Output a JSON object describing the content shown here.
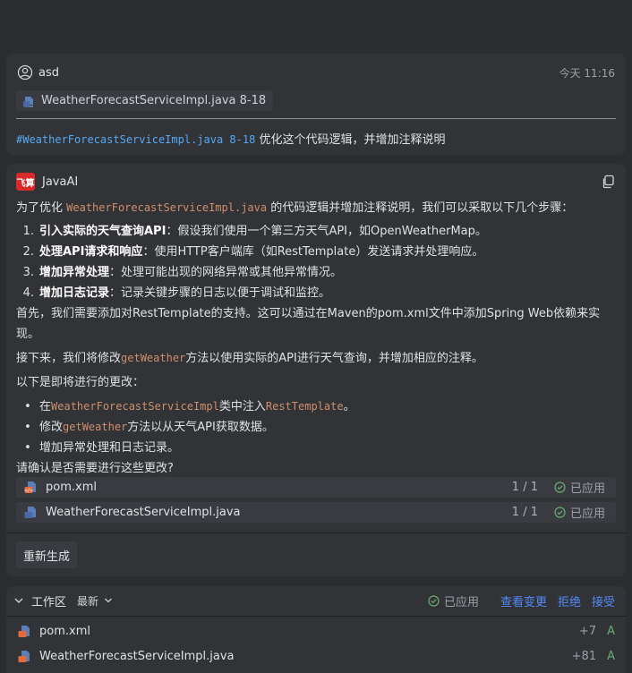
{
  "user": {
    "name": "asd",
    "time": "今天 11:16",
    "file_chip": "WeatherForecastServiceImpl.java 8-18",
    "message_ref": "#WeatherForecastServiceImpl.java 8-18",
    "message_text": " 优化这个代码逻辑，并增加注释说明"
  },
  "ai": {
    "logo_text": "飞算",
    "name": "JavaAI",
    "intro_pre": "为了优化 ",
    "intro_code": "WeatherForecastServiceImpl.java",
    "intro_post": " 的代码逻辑并增加注释说明，我们可以采取以下几个步骤：",
    "steps": [
      {
        "num": "1.",
        "bold": "引入实际的天气查询API",
        "text": "：假设我们使用一个第三方天气API，如OpenWeatherMap。"
      },
      {
        "num": "2.",
        "bold": "处理API请求和响应",
        "text": "：使用HTTP客户端库（如RestTemplate）发送请求并处理响应。"
      },
      {
        "num": "3.",
        "bold": "增加异常处理",
        "text": "：处理可能出现的网络异常或其他异常情况。"
      },
      {
        "num": "4.",
        "bold": "增加日志记录",
        "text": "：记录关键步骤的日志以便于调试和监控。"
      }
    ],
    "para1": "首先，我们需要添加对RestTemplate的支持。这可以通过在Maven的pom.xml文件中添加Spring Web依赖来实现。",
    "para2_pre": "接下来，我们将修改",
    "para2_code": "getWeather",
    "para2_post": "方法以使用实际的API进行天气查询，并增加相应的注释。",
    "para3": "以下是即将进行的更改：",
    "bullets": {
      "b1_pre": "在",
      "b1_code1": "WeatherForecastServiceImpl",
      "b1_mid": "类中注入",
      "b1_code2": "RestTemplate",
      "b1_post": "。",
      "b2_pre": "修改",
      "b2_code": "getWeather",
      "b2_post": "方法以从天气API获取数据。",
      "b3": "增加异常处理和日志记录。"
    },
    "confirm": "请确认是否需要进行这些更改?",
    "files": [
      {
        "name": "pom.xml",
        "count": "1 / 1",
        "status": "已应用"
      },
      {
        "name": "WeatherForecastServiceImpl.java",
        "count": "1 / 1",
        "status": "已应用"
      }
    ],
    "regen_label": "重新生成"
  },
  "workspace": {
    "title": "工作区",
    "latest": "最新",
    "applied": "已应用",
    "view_changes": "查看变更",
    "reject": "拒绝",
    "accept": "接受",
    "files": [
      {
        "name": "pom.xml",
        "diff": "+7",
        "vcs": "A"
      },
      {
        "name": "WeatherForecastServiceImpl.java",
        "diff": "+81",
        "vcs": "A"
      }
    ]
  },
  "colors": {
    "background": "#2b2d30",
    "card": "#313337",
    "link": "#548af7",
    "code": "#cf8e6d",
    "ref": "#56a8f5",
    "added": "#6aab73"
  }
}
